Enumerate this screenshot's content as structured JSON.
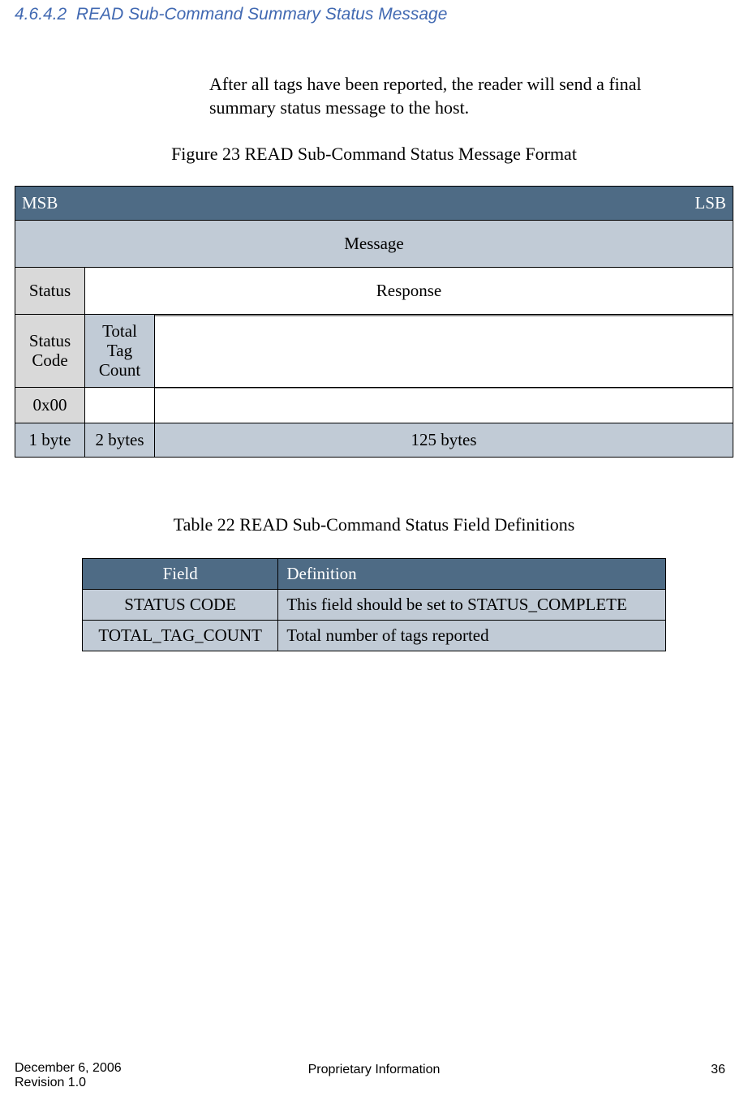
{
  "heading": {
    "number": "4.6.4.2",
    "title": "READ Sub-Command Summary Status Message"
  },
  "intro": "After all tags have been reported, the reader will send a final summary status message to the host.",
  "figure_caption": "Figure 23 READ Sub-Command Status Message Format",
  "msg_table": {
    "msb": "MSB",
    "lsb": "LSB",
    "message": "Message",
    "status": "Status",
    "response": "Response",
    "status_code": "Status Code",
    "total_tag_count": "Total Tag Count",
    "hex_value": "0x00",
    "bytes1": "1 byte",
    "bytes2": "2 bytes",
    "bytes125": "125 bytes"
  },
  "table_caption": "Table 22 READ Sub-Command Status Field Definitions",
  "def_table": {
    "field_header": "Field",
    "definition_header": "Definition",
    "rows": [
      {
        "field": "STATUS CODE",
        "definition": "This field should be set to STATUS_COMPLETE"
      },
      {
        "field": "TOTAL_TAG_COUNT",
        "definition": "Total number of tags reported"
      }
    ]
  },
  "footer": {
    "date": "December 6, 2006",
    "revision": "Revision 1.0",
    "center": "Proprietary Information",
    "page": "36"
  }
}
